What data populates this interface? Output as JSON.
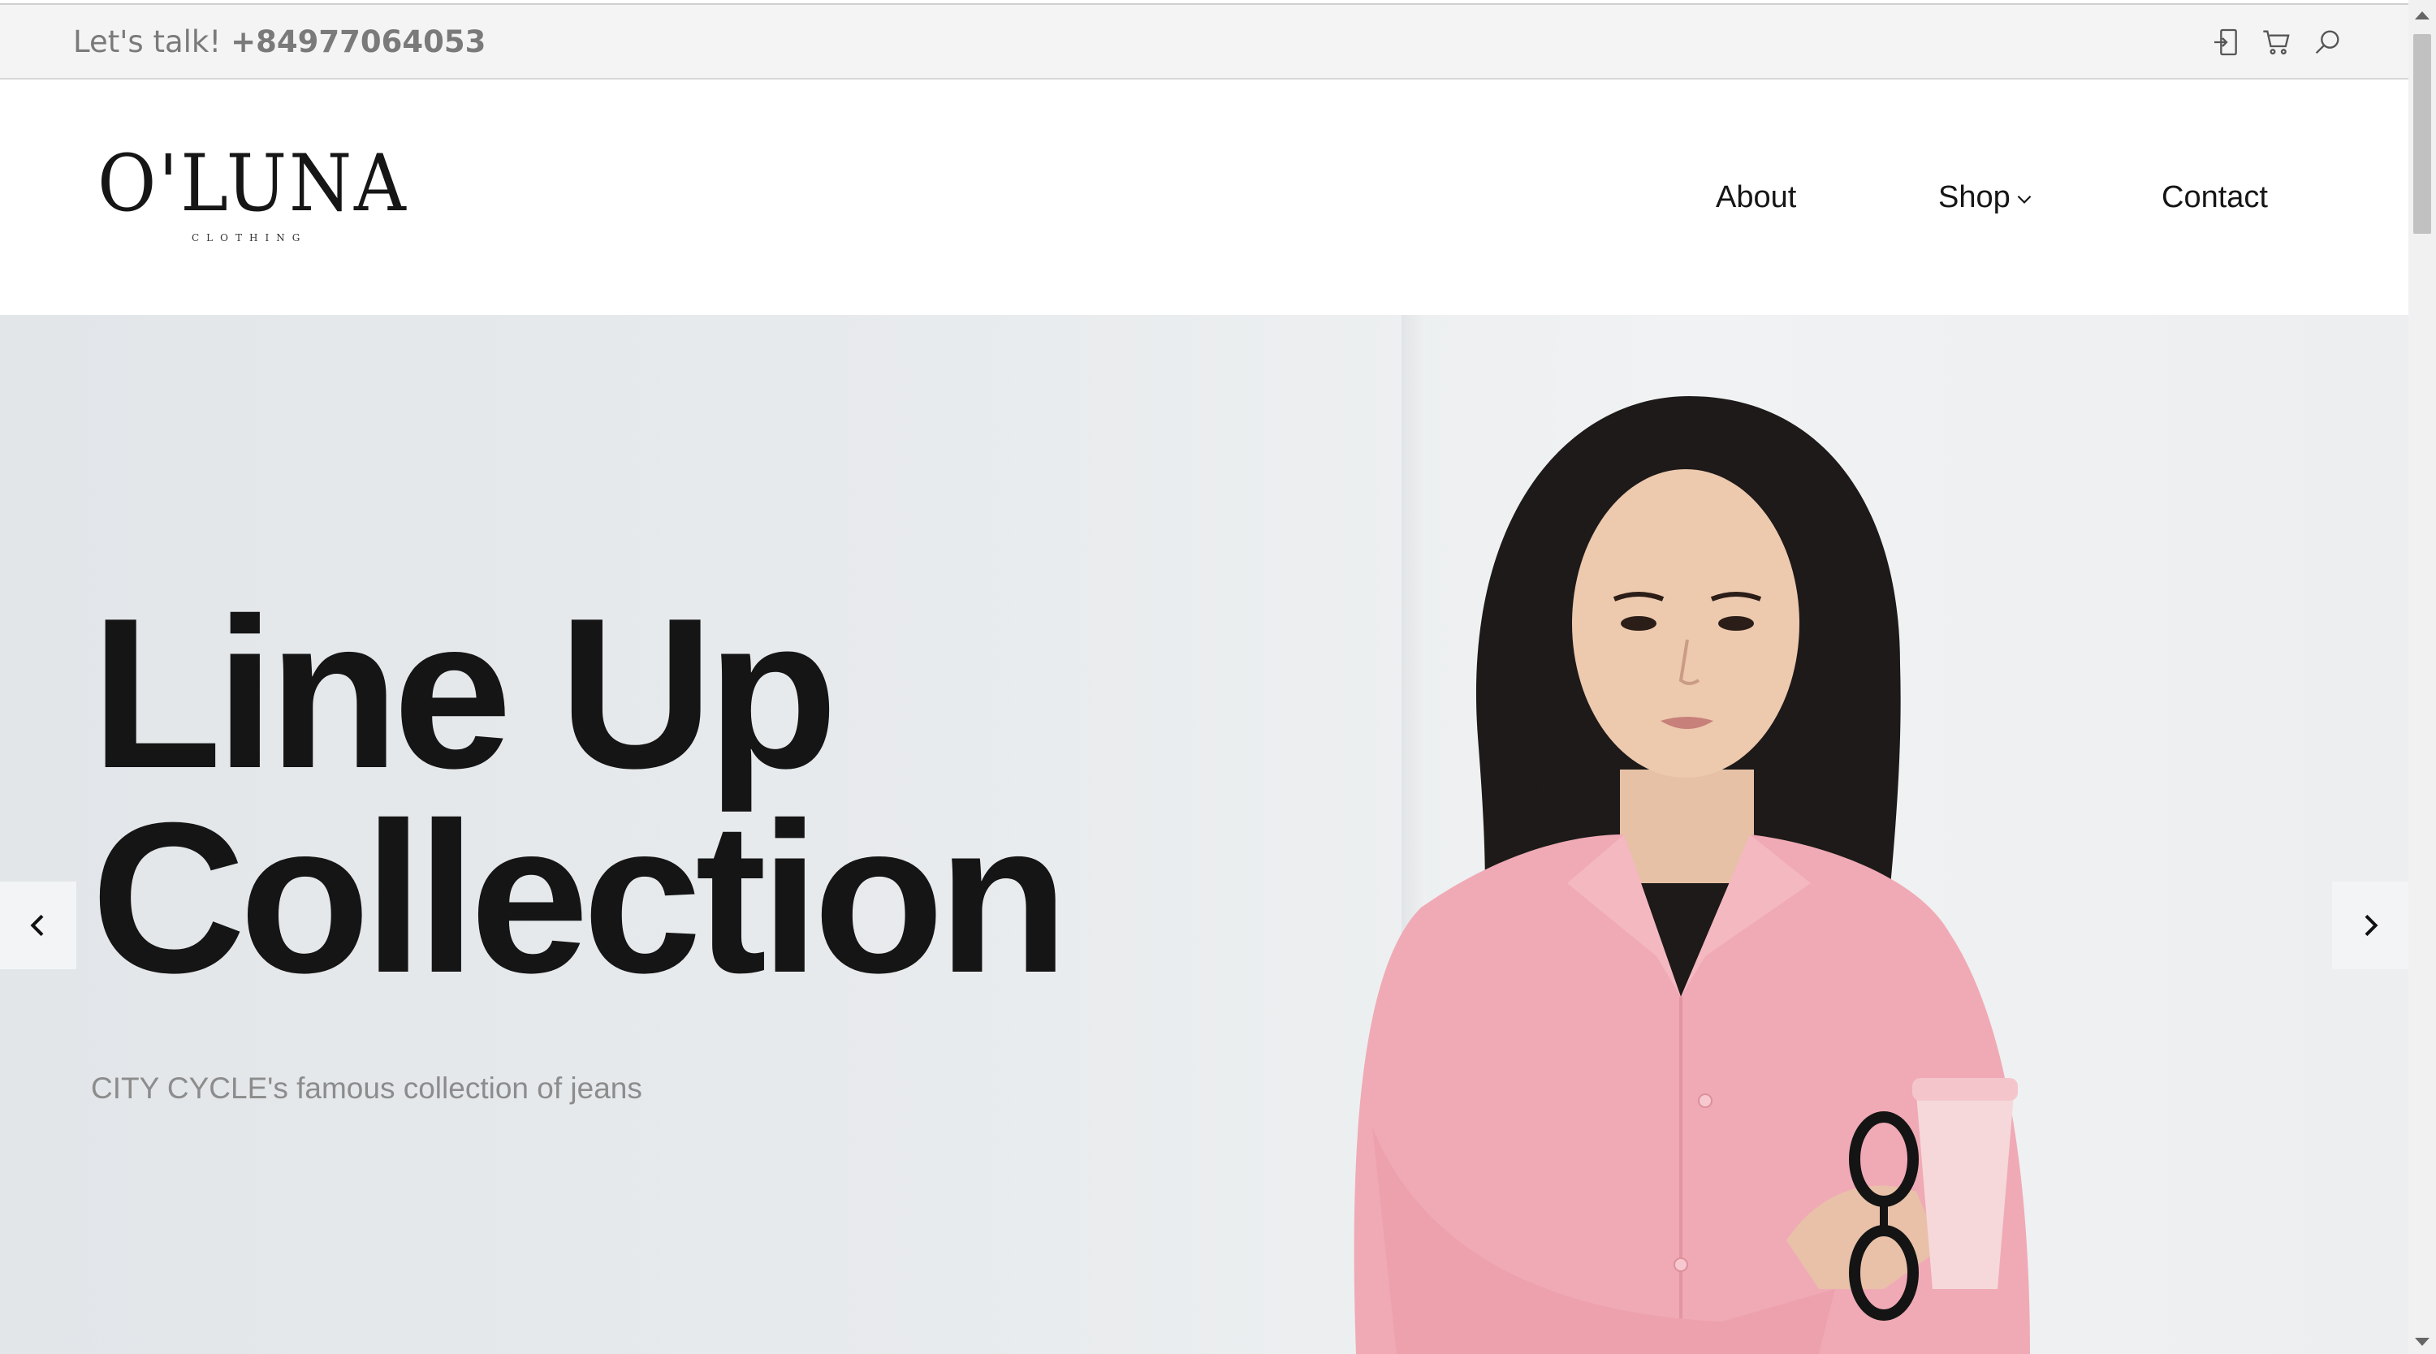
{
  "topbar": {
    "talk_label": "Let's talk!",
    "phone": "+84977064053",
    "icons": [
      "login-icon",
      "cart-icon",
      "search-icon"
    ]
  },
  "header": {
    "logo_text": "O'LUNA",
    "logo_sub": "CLOTHING",
    "nav": {
      "about": "About",
      "shop": "Shop",
      "contact": "Contact"
    }
  },
  "hero": {
    "title_line1": "Line Up",
    "title_line2": "Collection",
    "subtitle": "CITY CYCLE's famous collection of jeans",
    "prev_icon": "chevron-left-icon",
    "next_icon": "chevron-right-icon"
  },
  "colors": {
    "topbar_bg": "#f4f4f4",
    "hero_bg": "#e6e9eb",
    "title": "#151515",
    "subtitle": "#8c8c8c",
    "shirt": "#f0aab5"
  }
}
